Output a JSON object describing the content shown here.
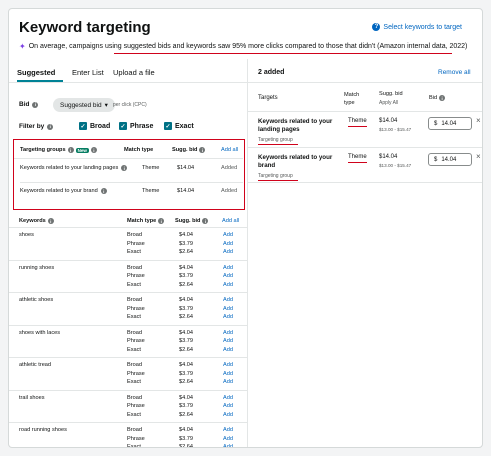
{
  "header": {
    "title": "Keyword targeting",
    "help_link": "Select keywords to target",
    "tip": "On average, campaigns using suggested bids and keywords saw 95% more clicks compared to those that didn't (Amazon internal data, 2022)"
  },
  "tabs": [
    "Suggested",
    "Enter List",
    "Upload a file"
  ],
  "bid": {
    "label": "Bid",
    "value": "Suggested bid",
    "suffix": "per click (CPC)"
  },
  "filter": {
    "label": "Filter by",
    "options": [
      "Broad",
      "Phrase",
      "Exact"
    ]
  },
  "targeting_groups": {
    "header": {
      "name": "Targeting groups",
      "badge": "New",
      "match": "Match type",
      "bid": "Sugg. bid",
      "add_all": "Add all"
    },
    "rows": [
      {
        "name": "Keywords related to your landing pages",
        "match": "Theme",
        "bid": "$14.04",
        "status": "Added"
      },
      {
        "name": "Keywords related to your brand",
        "match": "Theme",
        "bid": "$14.04",
        "status": "Added"
      }
    ]
  },
  "keywords": {
    "header": {
      "name": "Keywords",
      "match": "Match type",
      "bid": "Sugg. bid",
      "add_all": "Add all"
    },
    "groups": [
      {
        "keyword": "shoes",
        "rows": [
          {
            "match": "Broad",
            "bid": "$4.04",
            "action": "Add"
          },
          {
            "match": "Phrase",
            "bid": "$3.79",
            "action": "Add"
          },
          {
            "match": "Exact",
            "bid": "$2.64",
            "action": "Add"
          }
        ]
      },
      {
        "keyword": "running shoes",
        "rows": [
          {
            "match": "Broad",
            "bid": "$4.04",
            "action": "Add"
          },
          {
            "match": "Phrase",
            "bid": "$3.79",
            "action": "Add"
          },
          {
            "match": "Exact",
            "bid": "$2.64",
            "action": "Add"
          }
        ]
      },
      {
        "keyword": "athletic shoes",
        "rows": [
          {
            "match": "Broad",
            "bid": "$4.04",
            "action": "Add"
          },
          {
            "match": "Phrase",
            "bid": "$3.79",
            "action": "Add"
          },
          {
            "match": "Exact",
            "bid": "$2.64",
            "action": "Add"
          }
        ]
      },
      {
        "keyword": "shoes with laces",
        "rows": [
          {
            "match": "Broad",
            "bid": "$4.04",
            "action": "Add"
          },
          {
            "match": "Phrase",
            "bid": "$3.79",
            "action": "Add"
          },
          {
            "match": "Exact",
            "bid": "$2.64",
            "action": "Add"
          }
        ]
      },
      {
        "keyword": "athletic tread",
        "rows": [
          {
            "match": "Broad",
            "bid": "$4.04",
            "action": "Add"
          },
          {
            "match": "Phrase",
            "bid": "$3.79",
            "action": "Add"
          },
          {
            "match": "Exact",
            "bid": "$2.64",
            "action": "Add"
          }
        ]
      },
      {
        "keyword": "trail shoes",
        "rows": [
          {
            "match": "Broad",
            "bid": "$4.04",
            "action": "Add"
          },
          {
            "match": "Phrase",
            "bid": "$3.79",
            "action": "Add"
          },
          {
            "match": "Exact",
            "bid": "$2.64",
            "action": "Add"
          }
        ]
      },
      {
        "keyword": "road running shoes",
        "rows": [
          {
            "match": "Broad",
            "bid": "$4.04",
            "action": "Add"
          },
          {
            "match": "Phrase",
            "bid": "$3.79",
            "action": "Add"
          },
          {
            "match": "Exact",
            "bid": "$2.64",
            "action": "Add"
          }
        ]
      }
    ]
  },
  "added": {
    "count_label": "2 added",
    "remove_all": "Remove all",
    "header": {
      "targets": "Targets",
      "match": "Match type",
      "bid": "Sugg. bid",
      "apply_all": "Apply All",
      "bid_col": "Bid"
    },
    "rows": [
      {
        "name": "Keywords related to your landing pages",
        "sub": "Targeting group",
        "match": "Theme",
        "bid": "$14.04",
        "range": "$13.00 - $15.47",
        "input": "14.04"
      },
      {
        "name": "Keywords related to your brand",
        "sub": "Targeting group",
        "match": "Theme",
        "bid": "$14.04",
        "range": "$13.00 - $15.47",
        "input": "14.04"
      }
    ]
  },
  "colors": {
    "accent": "#007185",
    "link": "#0066c0",
    "highlight": "#d0021b",
    "new_badge": "#067d62"
  }
}
